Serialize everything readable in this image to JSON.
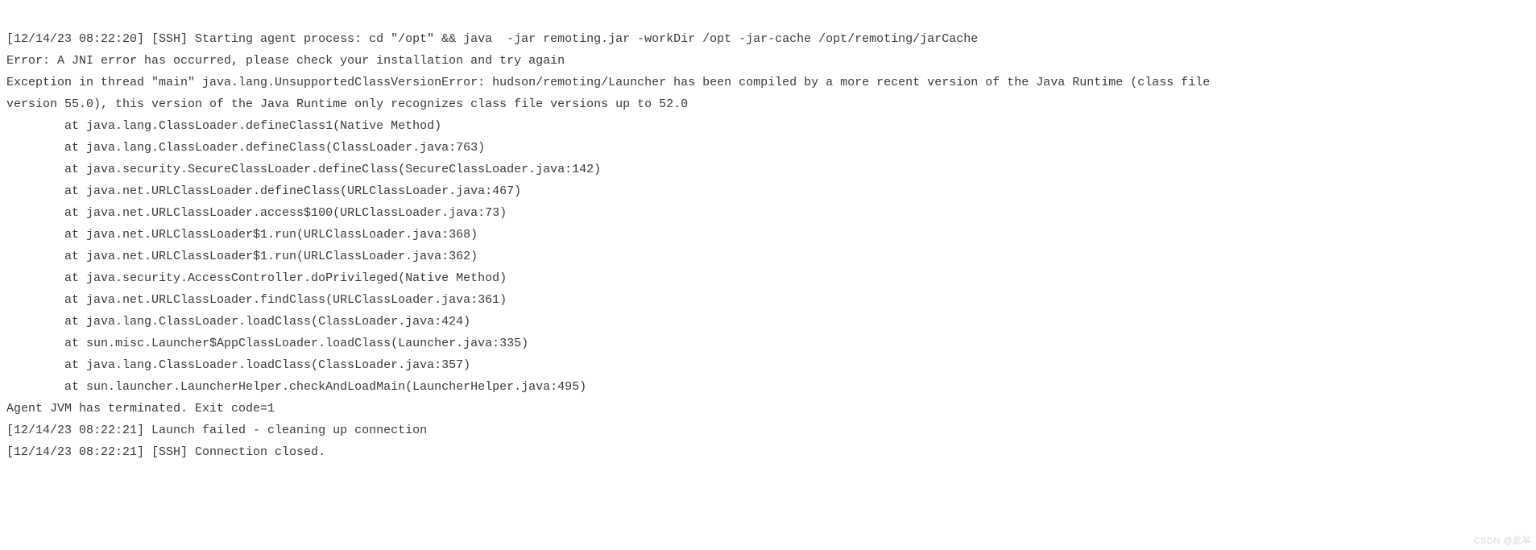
{
  "log": {
    "lines": [
      "[12/14/23 08:22:20] [SSH] Starting agent process: cd \"/opt\" && java  -jar remoting.jar -workDir /opt -jar-cache /opt/remoting/jarCache",
      "Error: A JNI error has occurred, please check your installation and try again",
      "Exception in thread \"main\" java.lang.UnsupportedClassVersionError: hudson/remoting/Launcher has been compiled by a more recent version of the Java Runtime (class file",
      "version 55.0), this version of the Java Runtime only recognizes class file versions up to 52.0",
      "        at java.lang.ClassLoader.defineClass1(Native Method)",
      "        at java.lang.ClassLoader.defineClass(ClassLoader.java:763)",
      "        at java.security.SecureClassLoader.defineClass(SecureClassLoader.java:142)",
      "        at java.net.URLClassLoader.defineClass(URLClassLoader.java:467)",
      "        at java.net.URLClassLoader.access$100(URLClassLoader.java:73)",
      "        at java.net.URLClassLoader$1.run(URLClassLoader.java:368)",
      "        at java.net.URLClassLoader$1.run(URLClassLoader.java:362)",
      "        at java.security.AccessController.doPrivileged(Native Method)",
      "        at java.net.URLClassLoader.findClass(URLClassLoader.java:361)",
      "        at java.lang.ClassLoader.loadClass(ClassLoader.java:424)",
      "        at sun.misc.Launcher$AppClassLoader.loadClass(Launcher.java:335)",
      "        at java.lang.ClassLoader.loadClass(ClassLoader.java:357)",
      "        at sun.launcher.LauncherHelper.checkAndLoadMain(LauncherHelper.java:495)",
      "Agent JVM has terminated. Exit code=1",
      "[12/14/23 08:22:21] Launch failed - cleaning up connection",
      "[12/14/23 08:22:21] [SSH] Connection closed."
    ]
  },
  "watermark": "CSDN @武半"
}
